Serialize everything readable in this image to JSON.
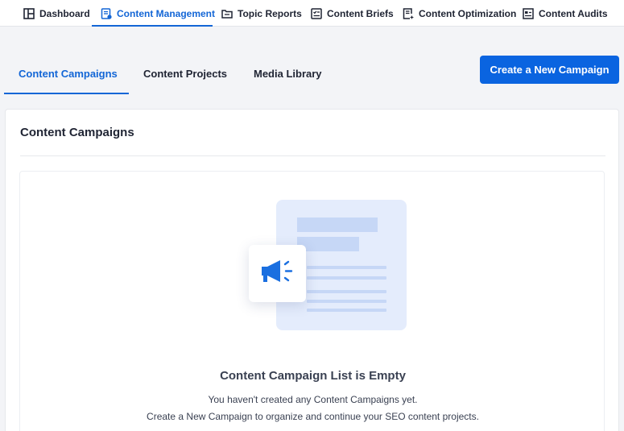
{
  "topnav": {
    "items": [
      {
        "label": "Dashboard",
        "icon": "dashboard-icon"
      },
      {
        "label": "Content Management",
        "icon": "content-management-icon",
        "active": true
      },
      {
        "label": "Topic Reports",
        "icon": "topic-reports-icon"
      },
      {
        "label": "Content Briefs",
        "icon": "content-briefs-icon"
      },
      {
        "label": "Content Optimization",
        "icon": "content-optimization-icon"
      },
      {
        "label": "Content Audits",
        "icon": "content-audits-icon"
      }
    ]
  },
  "subtabs": {
    "items": [
      {
        "label": "Content Campaigns",
        "active": true
      },
      {
        "label": "Content Projects"
      },
      {
        "label": "Media Library"
      }
    ]
  },
  "actions": {
    "create_label": "Create a New Campaign"
  },
  "card": {
    "title": "Content Campaigns",
    "empty_title": "Content Campaign List is Empty",
    "empty_line1": "You haven't created any Content Campaigns yet.",
    "empty_line2": "Create a New Campaign to organize and continue your SEO content projects.",
    "illustration_icon": "megaphone-icon"
  },
  "colors": {
    "accent": "#1366d6",
    "button": "#0a64e0",
    "illustration": "#e4ecfc"
  }
}
